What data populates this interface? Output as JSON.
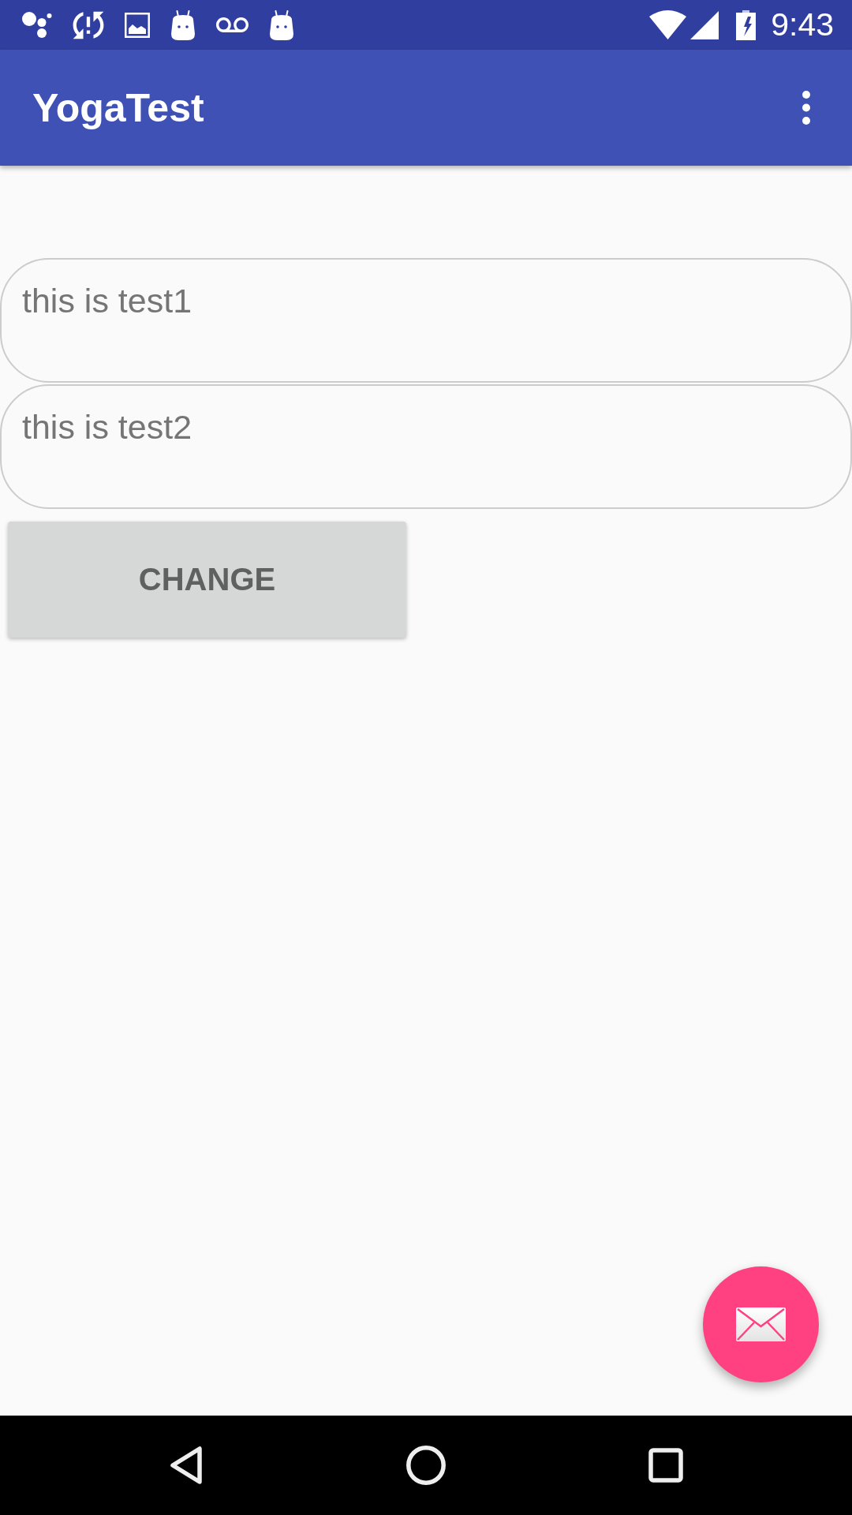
{
  "status_bar": {
    "time": "9:43"
  },
  "app_bar": {
    "title": "YogaTest"
  },
  "text_views": [
    {
      "text": "this is test1"
    },
    {
      "text": "this is test2"
    }
  ],
  "button": {
    "label": "CHANGE"
  }
}
